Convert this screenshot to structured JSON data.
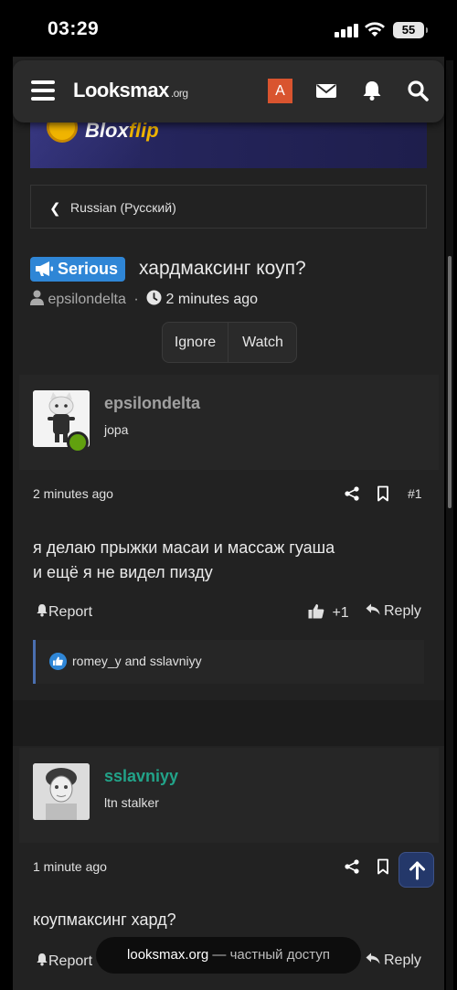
{
  "status_bar": {
    "time": "03:29",
    "battery": "55"
  },
  "nav": {
    "logo_main": "Looksmax",
    "logo_suffix": ".org",
    "user_initial": "A"
  },
  "banner": {
    "brand_a": "Blox",
    "brand_b": "flip"
  },
  "breadcrumb": {
    "label": "Russian (Русский)"
  },
  "thread": {
    "prefix": "Serious",
    "title": "хардмаксинг коуп?",
    "author": "epsilondelta",
    "separator": "·",
    "time": "2 minutes ago",
    "ignore_label": "Ignore",
    "watch_label": "Watch"
  },
  "posts": [
    {
      "username": "epsilondelta",
      "user_title": "jopa",
      "time": "2 minutes ago",
      "number": "#1",
      "body_line1": "я делаю прыжки масаи и массаж гуаша",
      "body_line2": "и ещё я не видел пизду",
      "report_label": "Report",
      "like_count": "+1",
      "reply_label": "Reply",
      "reactions_text": "romey_y and sslavniyy"
    },
    {
      "username": "sslavniyy",
      "user_title": "ltn stalker",
      "time": "1 minute ago",
      "body_line1": "коупмаксинг хард?",
      "report_label": "Report",
      "reply_label": "Reply"
    }
  ],
  "toast": {
    "site": "looksmax.org",
    "rest": "— частный доступ"
  },
  "colors": {
    "prefix_blue": "#2f86d6",
    "online_green": "#61a10f",
    "username_green": "#22a389",
    "avatar_orange": "#d9542f"
  }
}
